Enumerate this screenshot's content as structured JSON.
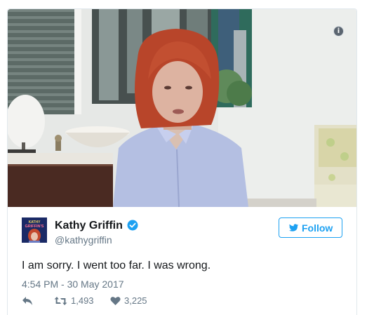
{
  "media": {
    "info_glyph": "i",
    "colors": {
      "wall": "#e6e8e6",
      "hair": "#b8452a",
      "shirt": "#b4bfe2"
    }
  },
  "author": {
    "name": "Kathy Griffin",
    "handle": "@kathygriffin",
    "avatar_text": [
      "KATHY",
      "GRIFFIN'S"
    ],
    "verified_icon": "verified-badge-icon"
  },
  "follow": {
    "label": "Follow",
    "icon": "twitter-bird-icon"
  },
  "tweet": {
    "text": "I am sorry. I went too far. I was wrong.",
    "timestamp": "4:54 PM - 30 May 2017"
  },
  "actions": {
    "reply": {
      "icon": "reply-icon"
    },
    "retweet": {
      "icon": "retweet-icon",
      "count": "1,493"
    },
    "like": {
      "icon": "heart-icon",
      "count": "3,225"
    }
  },
  "colors": {
    "accent": "#1da1f2",
    "text": "#14171a",
    "secondary": "#657786",
    "border": "#e1e8ed"
  }
}
